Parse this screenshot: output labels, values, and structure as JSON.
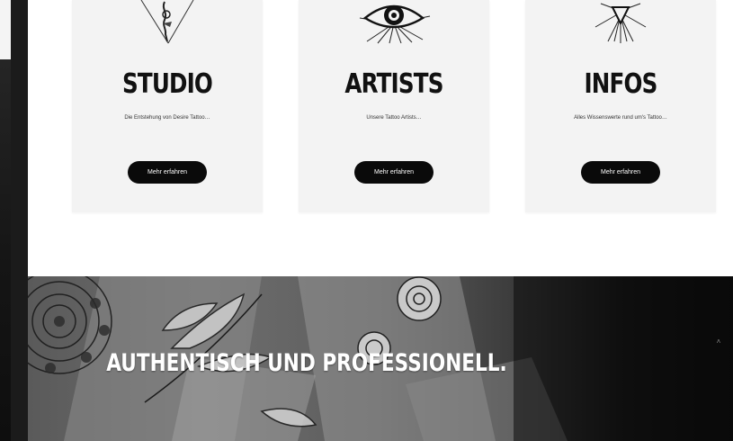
{
  "cards": [
    {
      "title": "STUDIO",
      "description": "Die Entstehung von Desire Tattoo…",
      "button_label": "Mehr erfahren",
      "illustration": "tattoo-machine-triangle-icon"
    },
    {
      "title": "ARTISTS",
      "description": "Unsere Tattoo Artists…",
      "button_label": "Mehr erfahren",
      "illustration": "eye-icon"
    },
    {
      "title": "INFOS",
      "description": "Alles Wissenswerte rund um's Tattoo…",
      "button_label": "Mehr erfahren",
      "illustration": "sunburst-heart-icon"
    }
  ],
  "banner": {
    "headline": "AUTHENTISCH UND PROFESSIONELL."
  },
  "scroll_top": {
    "icon": "chevron-up-icon",
    "glyph": "˄"
  },
  "colors": {
    "card_bg": "#f3f3f3",
    "button_bg": "#0a0a0a",
    "text_dark": "#111111"
  }
}
